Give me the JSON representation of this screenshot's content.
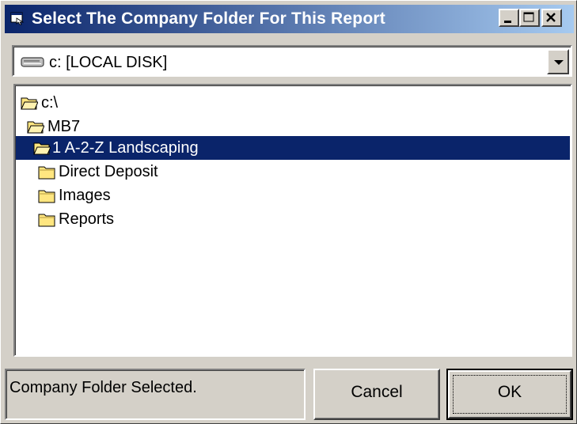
{
  "window": {
    "title": "Select The Company Folder For This Report",
    "controls": {
      "minimize_icon": "minimize-icon",
      "maximize_icon": "maximize-icon",
      "close_icon": "close-icon"
    }
  },
  "drive_combo": {
    "selected": "c: [LOCAL DISK]",
    "icon": "hard-drive-icon"
  },
  "folder_tree": [
    {
      "label": "c:\\",
      "state": "open",
      "selected": false
    },
    {
      "label": "MB7",
      "state": "open",
      "selected": false
    },
    {
      "label": "1 A-2-Z Landscaping",
      "state": "open",
      "selected": true
    },
    {
      "label": "Direct Deposit",
      "state": "closed",
      "selected": false
    },
    {
      "label": "Images",
      "state": "closed",
      "selected": false
    },
    {
      "label": "Reports",
      "state": "closed",
      "selected": false
    }
  ],
  "status": {
    "text": "Company Folder Selected."
  },
  "buttons": {
    "cancel": "Cancel",
    "ok": "OK"
  },
  "colors": {
    "title_start": "#0a246a",
    "title_end": "#a6caf0",
    "selection": "#0a246a",
    "face": "#d4d0c8",
    "folder": "#ffe680"
  }
}
